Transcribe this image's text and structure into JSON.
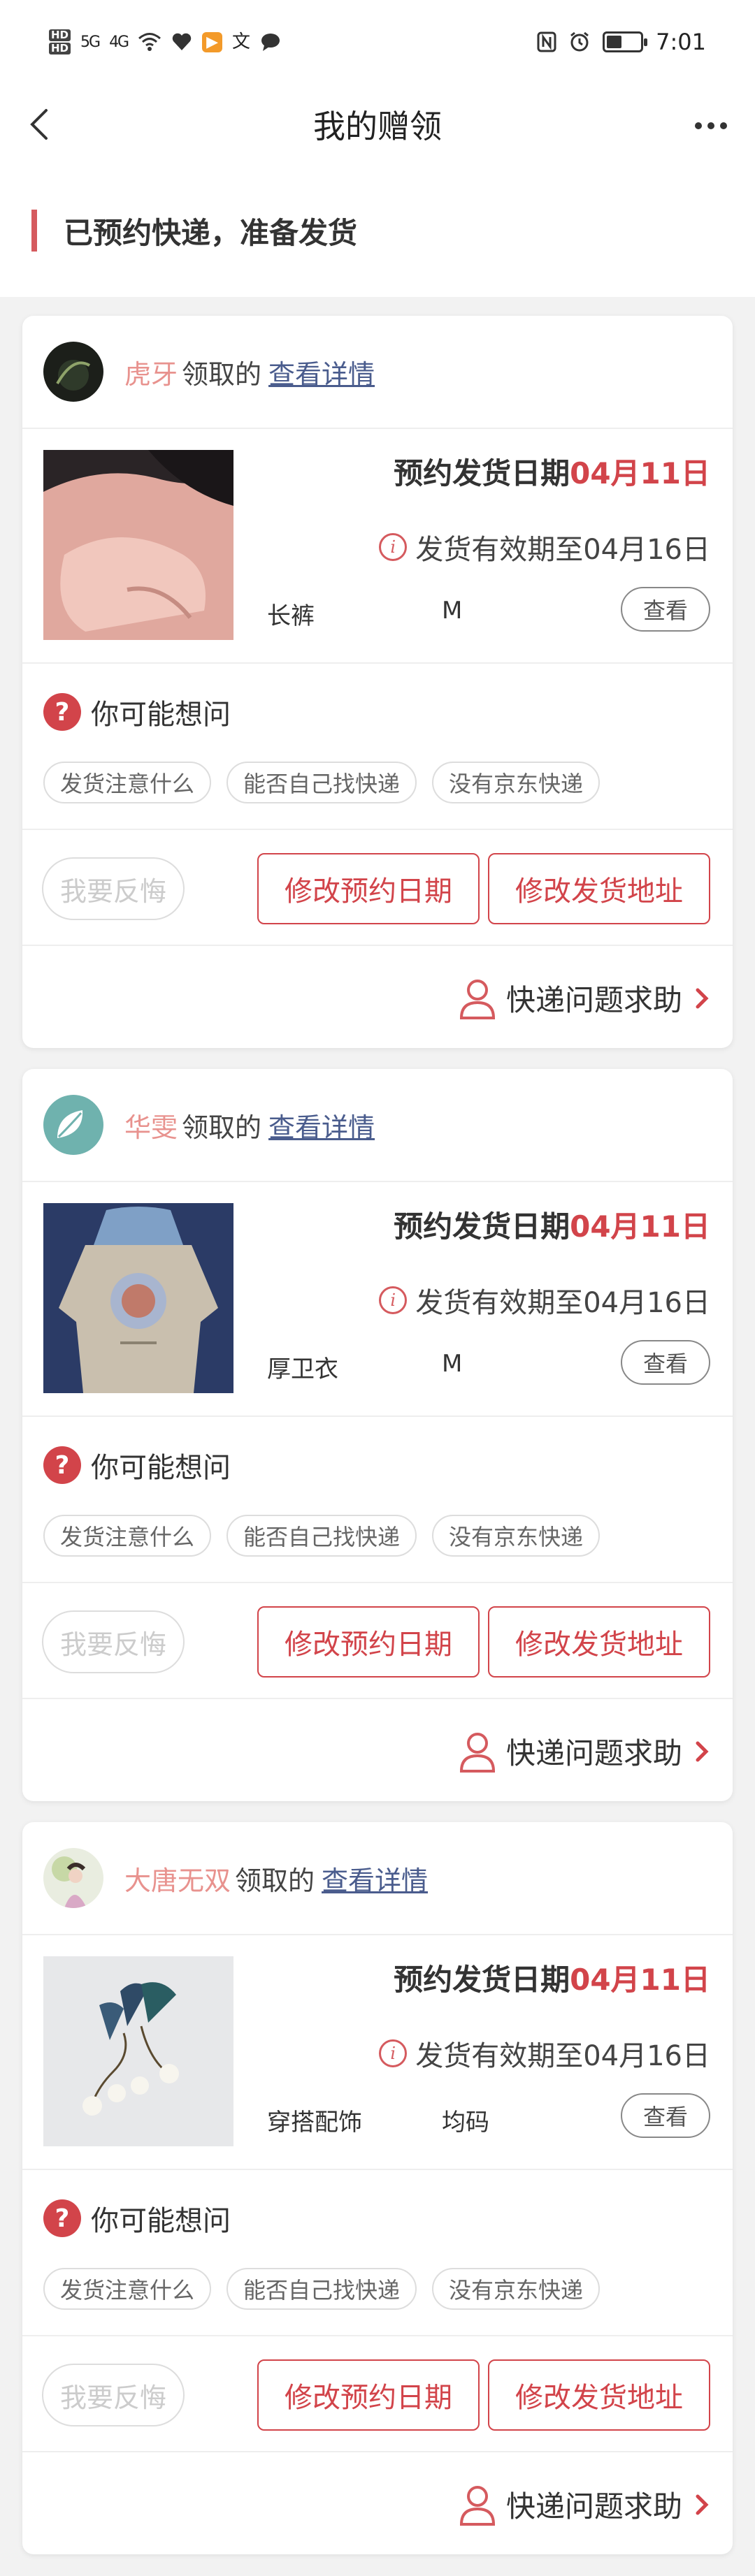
{
  "status_bar": {
    "hd_top": "HD",
    "hd_bottom": "HD",
    "signal1": "5G",
    "signal2": "4G",
    "translate_icon": "文",
    "time": "7:01"
  },
  "nav": {
    "title": "我的赠领"
  },
  "section": {
    "title": "已预约快递，准备发货"
  },
  "cards": [
    {
      "owner_name": "虎牙",
      "owner_mid": "领取的",
      "owner_link": "查看详情",
      "ship_label": "预约发货日期",
      "ship_date": "04月11日",
      "valid_text": "发货有效期至04月16日",
      "item_name": "长裤",
      "item_size": "M",
      "view_label": "查看",
      "qa_title": "你可能想问",
      "chips": [
        "发货注意什么",
        "能否自己找快递",
        "没有京东快递"
      ],
      "regret_label": "我要反悔",
      "modify_date_label": "修改预约日期",
      "modify_addr_label": "修改发货地址",
      "help_label": "快递问题求助"
    },
    {
      "owner_name": "华雯",
      "owner_mid": "领取的",
      "owner_link": "查看详情",
      "ship_label": "预约发货日期",
      "ship_date": "04月11日",
      "valid_text": "发货有效期至04月16日",
      "item_name": "厚卫衣",
      "item_size": "M",
      "view_label": "查看",
      "qa_title": "你可能想问",
      "chips": [
        "发货注意什么",
        "能否自己找快递",
        "没有京东快递"
      ],
      "regret_label": "我要反悔",
      "modify_date_label": "修改预约日期",
      "modify_addr_label": "修改发货地址",
      "help_label": "快递问题求助"
    },
    {
      "owner_name": "大唐无双",
      "owner_mid": "领取的",
      "owner_link": "查看详情",
      "ship_label": "预约发货日期",
      "ship_date": "04月11日",
      "valid_text": "发货有效期至04月16日",
      "item_name": "穿搭配饰",
      "item_size": "均码",
      "view_label": "查看",
      "qa_title": "你可能想问",
      "chips": [
        "发货注意什么",
        "能否自己找快递",
        "没有京东快递"
      ],
      "regret_label": "我要反悔",
      "modify_date_label": "修改预约日期",
      "modify_addr_label": "修改发货地址",
      "help_label": "快递问题求助"
    }
  ],
  "colors": {
    "accent": "#d2444a",
    "name_pink": "#e8928e",
    "link_blue": "#4a5c8d"
  }
}
